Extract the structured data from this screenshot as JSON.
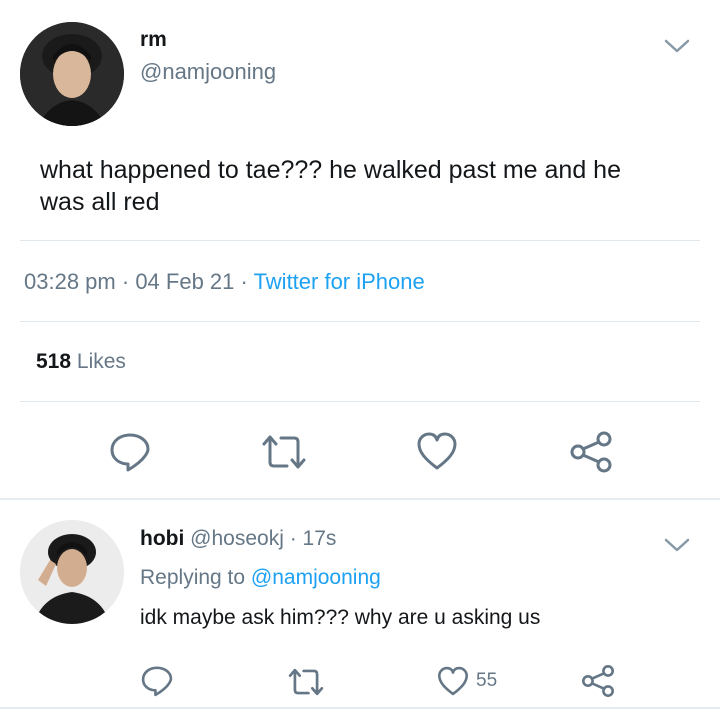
{
  "main_tweet": {
    "display_name": "rm",
    "handle": "@namjooning",
    "text": "what happened to tae??? he walked past me and he was all red",
    "time": "03:28 pm",
    "date": "04 Feb 21",
    "separator": "·",
    "source": "Twitter for iPhone",
    "likes_count": "518",
    "likes_label": "Likes",
    "actions": [
      "reply-icon",
      "retweet-icon",
      "like-icon",
      "share-icon"
    ]
  },
  "reply_tweet": {
    "display_name": "hobi",
    "handle": "@hoseokj",
    "time": "· 17s",
    "replying_label": "Replying to",
    "replying_handle": "@namjooning",
    "text": "idk maybe ask him??? why are u asking us",
    "like_count": "55",
    "actions": [
      "reply-icon",
      "retweet-icon",
      "like-icon",
      "share-icon"
    ]
  },
  "colors": {
    "accent": "#1da1f2",
    "muted": "#657786",
    "text": "#14171a",
    "divider": "#e1e8ed"
  }
}
